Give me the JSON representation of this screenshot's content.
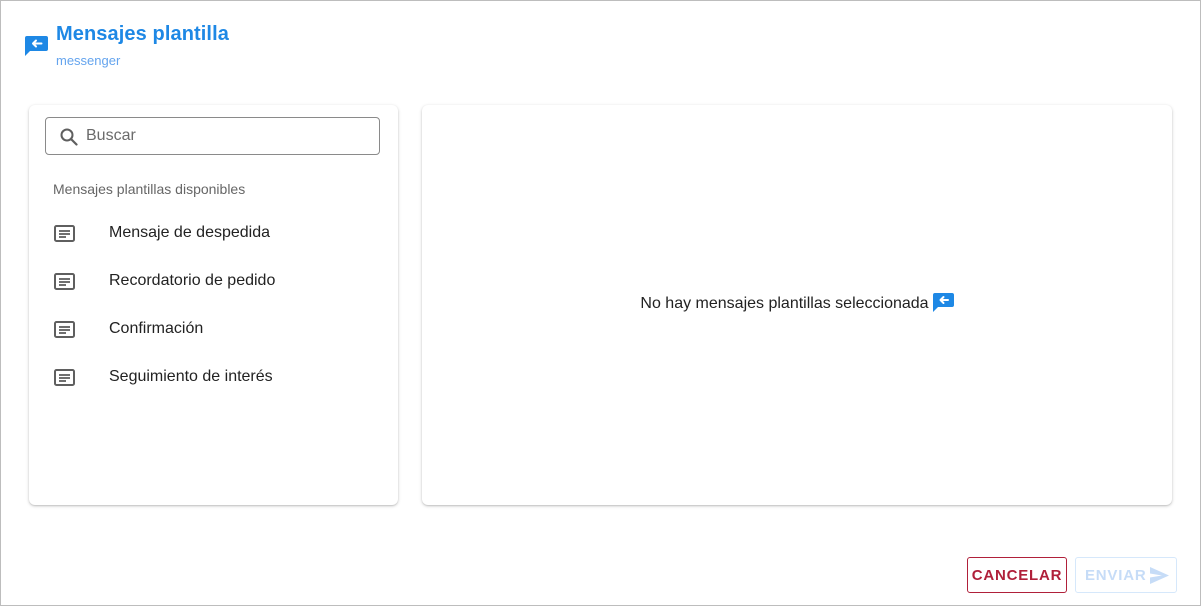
{
  "header": {
    "title": "Mensajes plantilla",
    "subtitle": "messenger",
    "icon": "messenger-reply-icon"
  },
  "search": {
    "placeholder": "Buscar",
    "value": ""
  },
  "templates": {
    "header": "Mensajes plantillas disponibles",
    "items": [
      {
        "label": "Mensaje de despedida",
        "icon": "message-text-icon"
      },
      {
        "label": "Recordatorio de pedido",
        "icon": "message-text-icon"
      },
      {
        "label": "Confirmación",
        "icon": "message-text-icon"
      },
      {
        "label": "Seguimiento de interés",
        "icon": "message-text-icon"
      }
    ]
  },
  "preview": {
    "empty_text": "No hay mensajes plantillas seleccionada"
  },
  "actions": {
    "cancel_label": "CANCELAR",
    "send_label": "ENVIAR"
  },
  "colors": {
    "accent": "#1e88e5",
    "cancel": "#b0203a",
    "send_disabled": "#c6dcf7"
  }
}
